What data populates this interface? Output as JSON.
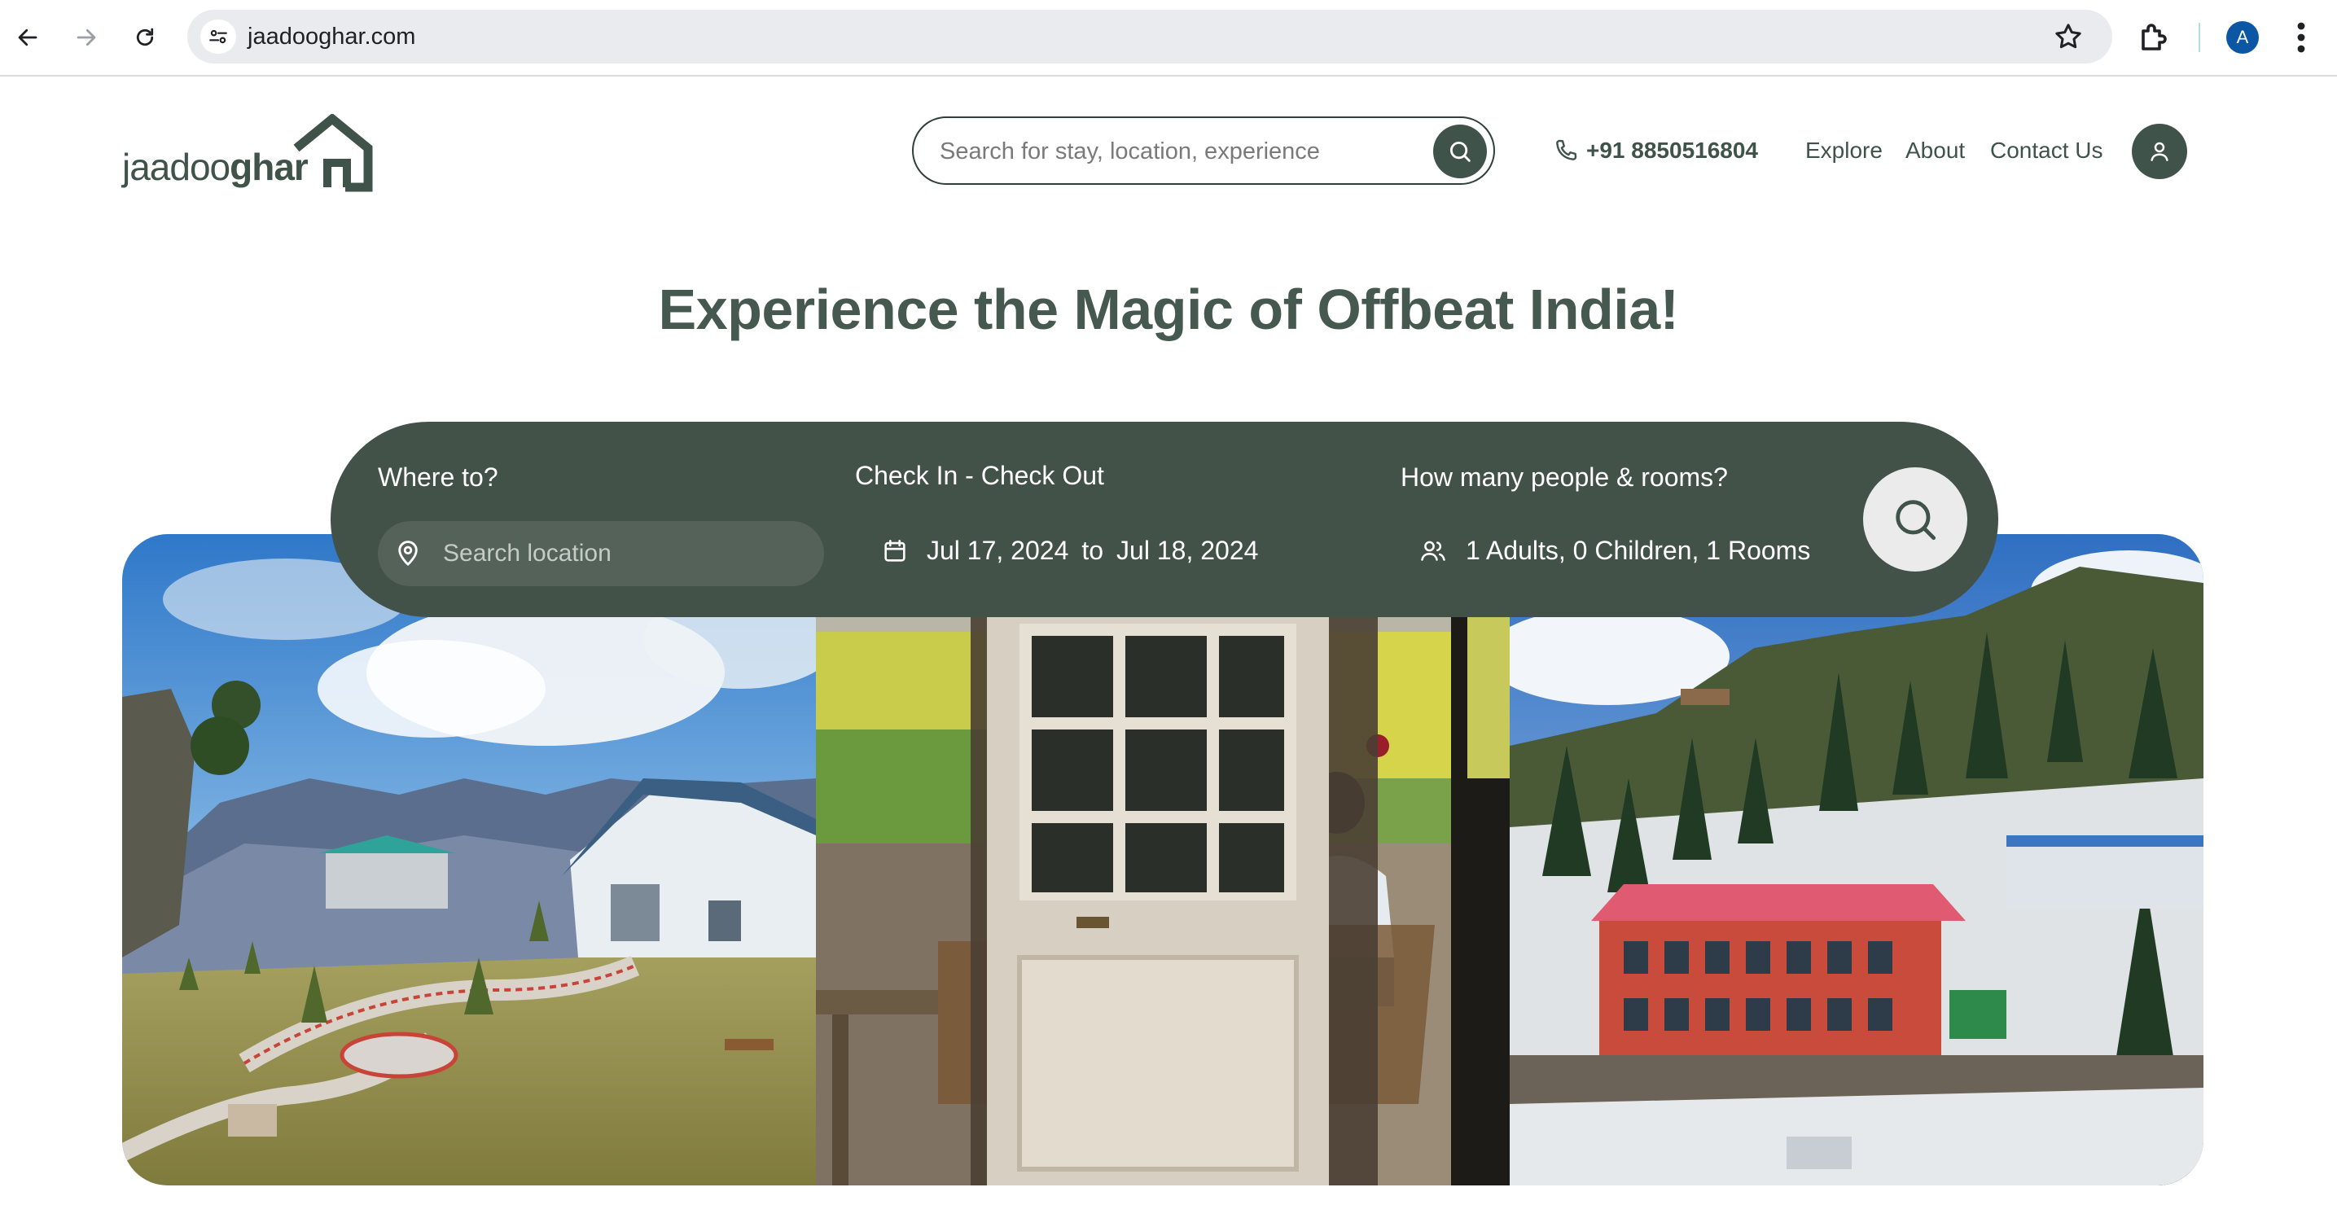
{
  "browser": {
    "url": "jaadooghar.com",
    "profile_initial": "A",
    "icons": [
      "back-arrow-icon",
      "forward-arrow-icon",
      "reload-icon",
      "site-settings-icon",
      "bookmark-star-icon",
      "extensions-icon",
      "menu-kebab-icon"
    ]
  },
  "header": {
    "logo": {
      "light": "jaadoo",
      "bold": "ghar"
    },
    "search_placeholder": "Search for stay, location, experience",
    "phone": "+91 8850516804",
    "nav": [
      "Explore",
      "About",
      "Contact Us"
    ]
  },
  "hero": {
    "title": "Experience the Magic of Offbeat India!"
  },
  "booking": {
    "where_label": "Where to?",
    "location_placeholder": "Search location",
    "dates_label": "Check In - Check Out",
    "check_in": "Jul 17, 2024",
    "to": "to",
    "check_out": "Jul 18, 2024",
    "guests_label": "How many people & rooms?",
    "guests_value": "1 Adults, 0 Children, 1 Rooms"
  },
  "colors": {
    "brand": "#3f534b",
    "search_bar": "#435249",
    "title": "#465950"
  }
}
